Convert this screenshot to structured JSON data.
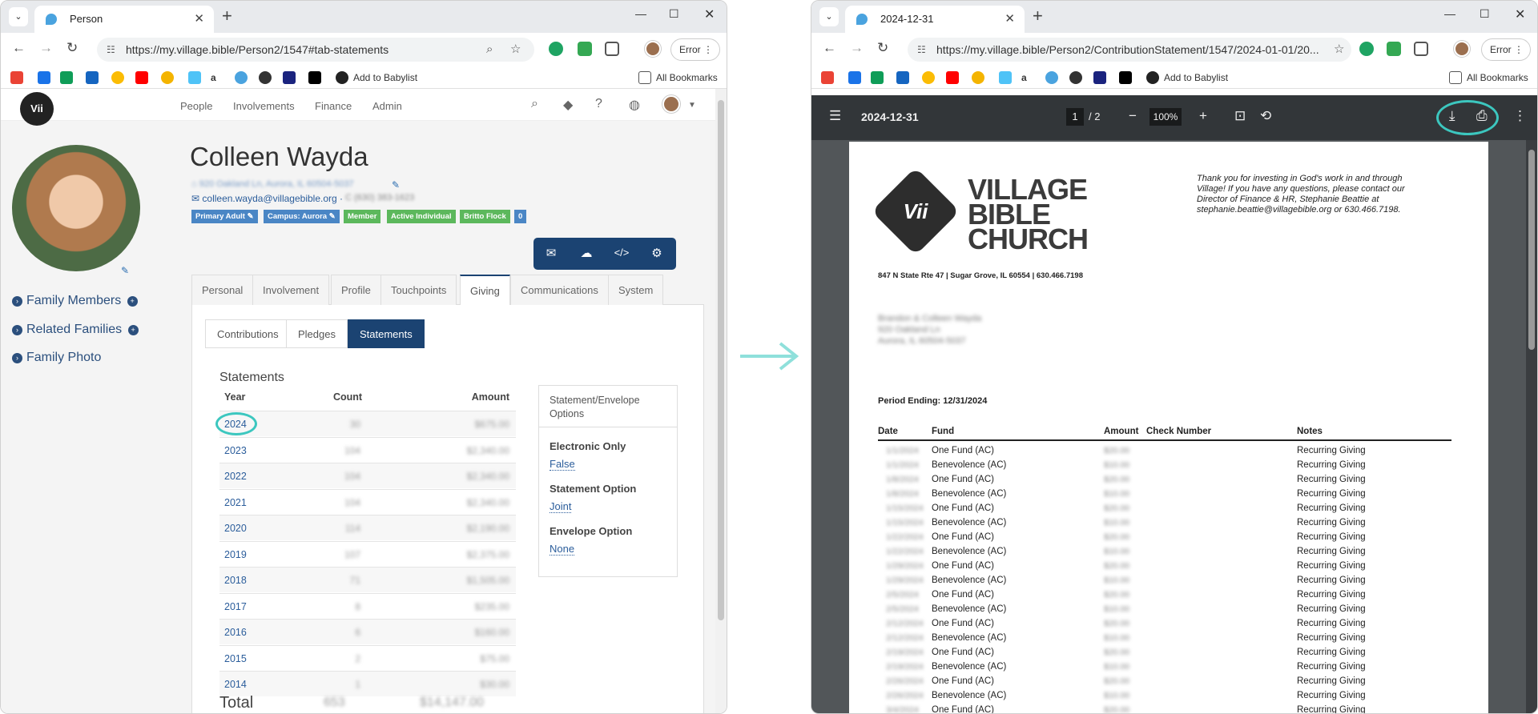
{
  "left": {
    "tab_title": "Person",
    "url": "https://my.village.bible/Person2/1547#tab-statements",
    "error_label": "Error",
    "bookmark_babylist": "Add to Babylist",
    "all_bookmarks": "All Bookmarks",
    "nav": [
      "People",
      "Involvements",
      "Finance",
      "Admin"
    ],
    "person": {
      "name": "Colleen Wayda",
      "address": "920 Oakland Ln, Aurora, IL 60504-5037",
      "email": "colleen.wayda@villagebible.org",
      "phone": "C (630) 383-1623",
      "badges": [
        {
          "label": "Primary Adult ✎",
          "color": "#4a86c5"
        },
        {
          "label": "Campus: Aurora ✎",
          "color": "#4a86c5"
        },
        {
          "label": "Member",
          "color": "#5cb85c"
        },
        {
          "label": "Active Individual",
          "color": "#5cb85c"
        },
        {
          "label": "Britto Flock",
          "color": "#5cb85c"
        },
        {
          "label": "0",
          "color": "#4a86c5"
        }
      ]
    },
    "sidebar": [
      "Family Members",
      "Related Families",
      "Family Photo"
    ],
    "tabs": [
      "Personal",
      "Involvement",
      "Profile",
      "Touchpoints",
      "Giving",
      "Communications",
      "System"
    ],
    "active_tab": "Giving",
    "subtabs": [
      "Contributions",
      "Pledges",
      "Statements"
    ],
    "statements": {
      "title": "Statements",
      "headers": {
        "year": "Year",
        "count": "Count",
        "amount": "Amount"
      },
      "rows": [
        {
          "year": "2024",
          "count": "30",
          "amount": "$675.00"
        },
        {
          "year": "2023",
          "count": "104",
          "amount": "$2,340.00"
        },
        {
          "year": "2022",
          "count": "104",
          "amount": "$2,340.00"
        },
        {
          "year": "2021",
          "count": "104",
          "amount": "$2,340.00"
        },
        {
          "year": "2020",
          "count": "114",
          "amount": "$2,190.00"
        },
        {
          "year": "2019",
          "count": "107",
          "amount": "$2,375.00"
        },
        {
          "year": "2018",
          "count": "71",
          "amount": "$1,505.00"
        },
        {
          "year": "2017",
          "count": "8",
          "amount": "$235.00"
        },
        {
          "year": "2016",
          "count": "6",
          "amount": "$160.00"
        },
        {
          "year": "2015",
          "count": "2",
          "amount": "$75.00"
        },
        {
          "year": "2014",
          "count": "1",
          "amount": "$30.00"
        }
      ],
      "total_label": "Total",
      "total_count": "653",
      "total_amount": "$14,147.00"
    },
    "options": {
      "header": "Statement/Envelope Options",
      "electronic_label": "Electronic Only",
      "electronic_value": "False",
      "statement_label": "Statement Option",
      "statement_value": "Joint",
      "envelope_label": "Envelope Option",
      "envelope_value": "None"
    }
  },
  "right": {
    "tab_title": "2024-12-31",
    "url": "https://my.village.bible/Person2/ContributionStatement/1547/2024-01-01/20...",
    "error_label": "Error",
    "bookmark_babylist": "Add to Babylist",
    "all_bookmarks": "All Bookmarks",
    "pdf": {
      "title": "2024-12-31",
      "page": "1",
      "page_total": "/ 2",
      "zoom": "100%"
    },
    "statement": {
      "logo_line1": "VILLAGE",
      "logo_line2": "BIBLE",
      "logo_line3": "CHURCH",
      "church_address": "847 N State Rte 47 | Sugar Grove, IL 60554 | 630.466.7198",
      "thanks": "Thank you for investing in God's work in and through Village!  If you have any questions, please contact our Director of Finance & HR, Stephanie Beattie at stephanie.beattie@villagebible.org or 630.466.7198.",
      "recipient_line1": "Brandon & Colleen Wayda",
      "recipient_line2": "920 Oakland Ln",
      "recipient_line3": "Aurora, IL 60504-5037",
      "period": "Period Ending: 12/31/2024",
      "headers": {
        "date": "Date",
        "fund": "Fund",
        "amount": "Amount",
        "check": "Check Number",
        "notes": "Notes"
      },
      "rows": [
        {
          "date": "1/1/2024",
          "fund": "One Fund (AC)",
          "amount": "$20.00",
          "notes": "Recurring Giving"
        },
        {
          "date": "1/1/2024",
          "fund": "Benevolence (AC)",
          "amount": "$10.00",
          "notes": "Recurring Giving"
        },
        {
          "date": "1/8/2024",
          "fund": "One Fund (AC)",
          "amount": "$20.00",
          "notes": "Recurring Giving"
        },
        {
          "date": "1/8/2024",
          "fund": "Benevolence (AC)",
          "amount": "$10.00",
          "notes": "Recurring Giving"
        },
        {
          "date": "1/15/2024",
          "fund": "One Fund (AC)",
          "amount": "$20.00",
          "notes": "Recurring Giving"
        },
        {
          "date": "1/15/2024",
          "fund": "Benevolence (AC)",
          "amount": "$10.00",
          "notes": "Recurring Giving"
        },
        {
          "date": "1/22/2024",
          "fund": "One Fund (AC)",
          "amount": "$20.00",
          "notes": "Recurring Giving"
        },
        {
          "date": "1/22/2024",
          "fund": "Benevolence (AC)",
          "amount": "$10.00",
          "notes": "Recurring Giving"
        },
        {
          "date": "1/29/2024",
          "fund": "One Fund (AC)",
          "amount": "$20.00",
          "notes": "Recurring Giving"
        },
        {
          "date": "1/29/2024",
          "fund": "Benevolence (AC)",
          "amount": "$10.00",
          "notes": "Recurring Giving"
        },
        {
          "date": "2/5/2024",
          "fund": "One Fund (AC)",
          "amount": "$20.00",
          "notes": "Recurring Giving"
        },
        {
          "date": "2/5/2024",
          "fund": "Benevolence (AC)",
          "amount": "$10.00",
          "notes": "Recurring Giving"
        },
        {
          "date": "2/12/2024",
          "fund": "One Fund (AC)",
          "amount": "$20.00",
          "notes": "Recurring Giving"
        },
        {
          "date": "2/12/2024",
          "fund": "Benevolence (AC)",
          "amount": "$10.00",
          "notes": "Recurring Giving"
        },
        {
          "date": "2/19/2024",
          "fund": "One Fund (AC)",
          "amount": "$20.00",
          "notes": "Recurring Giving"
        },
        {
          "date": "2/19/2024",
          "fund": "Benevolence (AC)",
          "amount": "$10.00",
          "notes": "Recurring Giving"
        },
        {
          "date": "2/26/2024",
          "fund": "One Fund (AC)",
          "amount": "$20.00",
          "notes": "Recurring Giving"
        },
        {
          "date": "2/26/2024",
          "fund": "Benevolence (AC)",
          "amount": "$10.00",
          "notes": "Recurring Giving"
        },
        {
          "date": "3/4/2024",
          "fund": "One Fund (AC)",
          "amount": "$20.00",
          "notes": "Recurring Giving"
        }
      ]
    }
  },
  "colors": {
    "brand_navy": "#1b4372",
    "highlight_teal": "#3cc7bf",
    "link_blue": "#2b5d9b",
    "pdf_toolbar": "#323639"
  }
}
